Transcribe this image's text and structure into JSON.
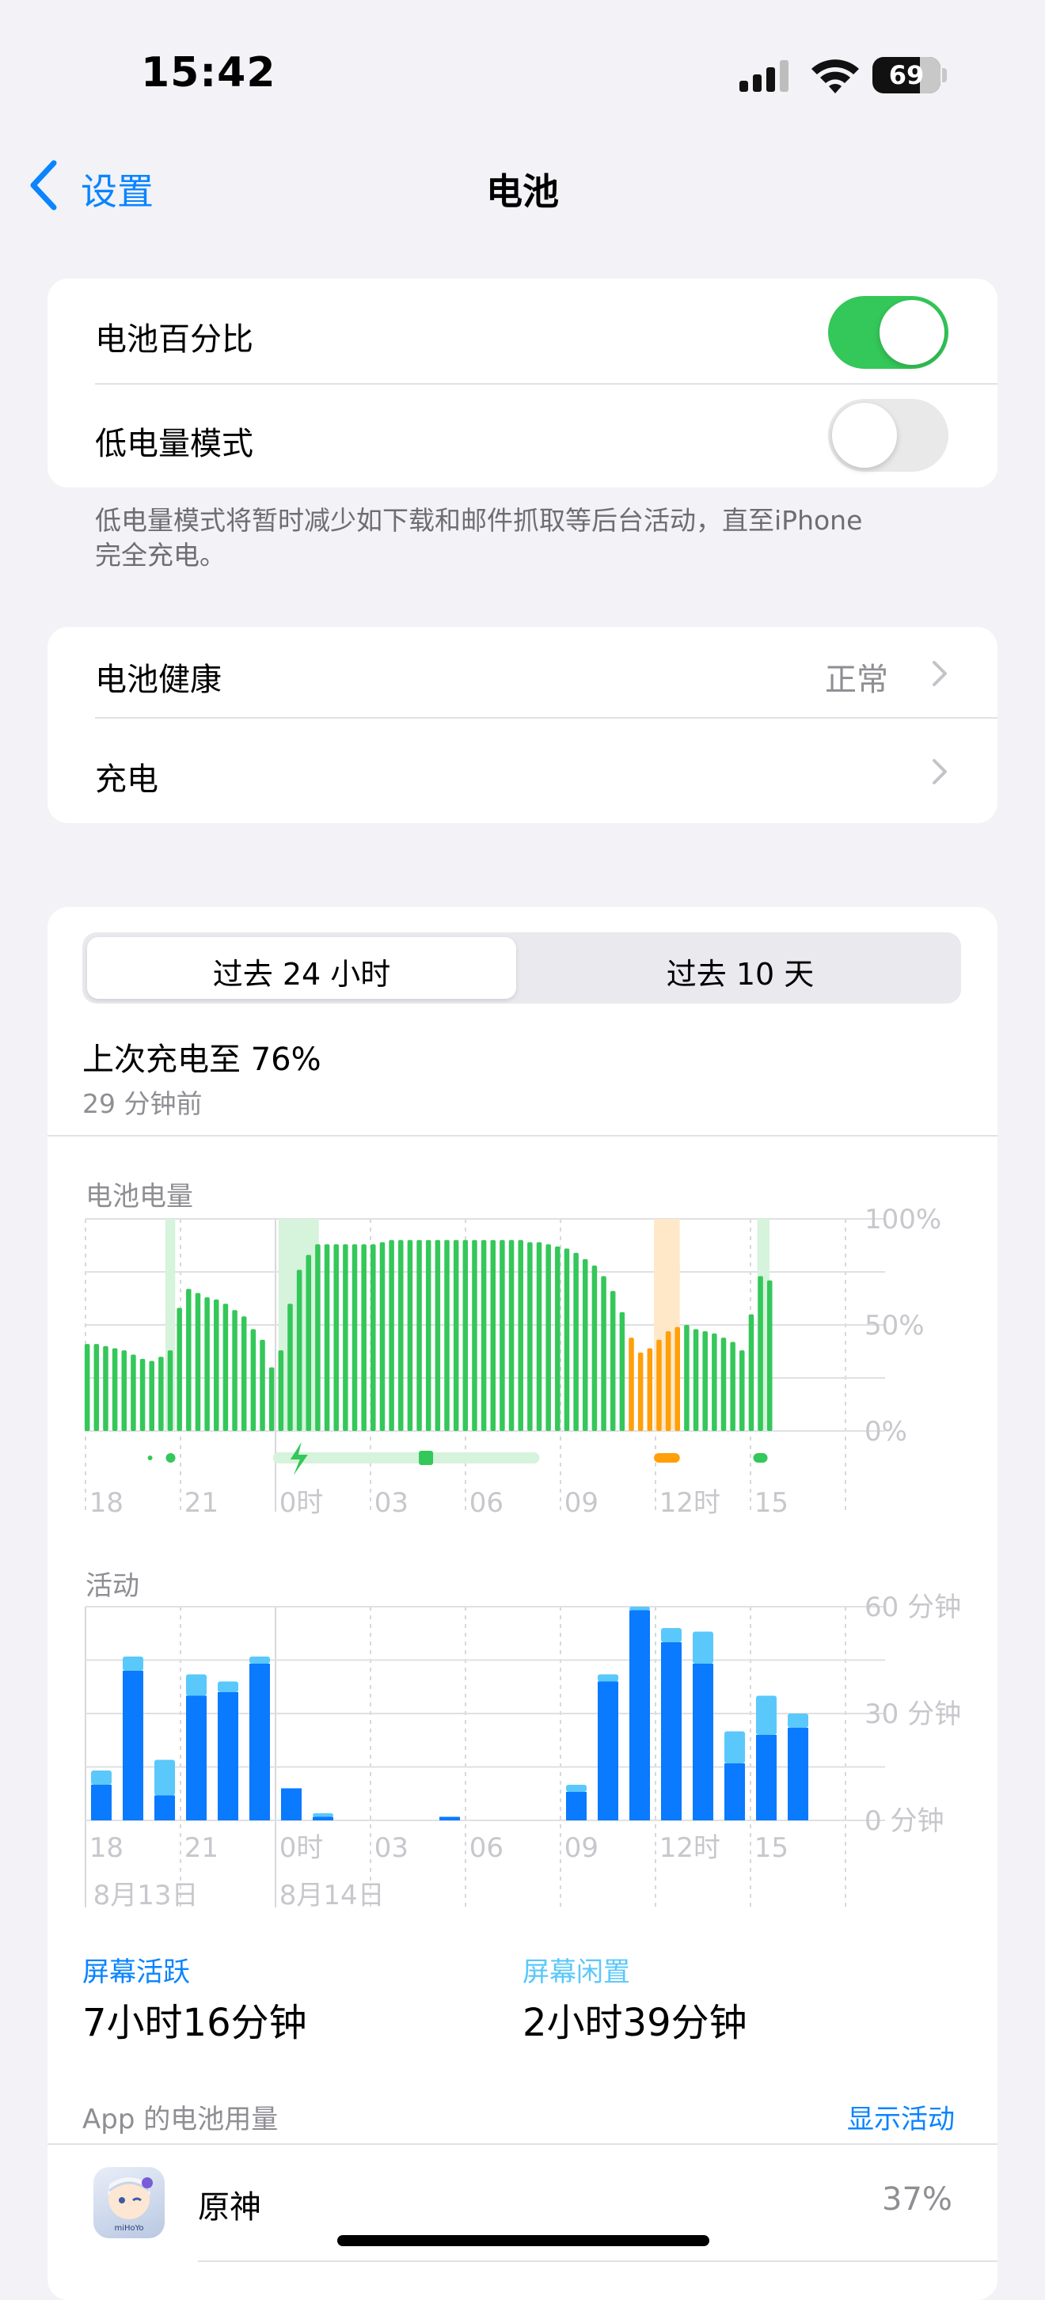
{
  "status_bar": {
    "time": "15:42",
    "battery_level": "69"
  },
  "nav": {
    "back_label": "设置",
    "title": "电池"
  },
  "toggles_section": {
    "battery_percentage_label": "电池百分比",
    "battery_percentage_on": true,
    "low_power_label": "低电量模式",
    "low_power_on": false,
    "footnote_line1": "低电量模式将暂时减少如下载和邮件抓取等后台活动，直至iPhone",
    "footnote_line2": "完全充电。"
  },
  "health_section": {
    "health_label": "电池健康",
    "health_value": "正常",
    "charging_label": "充电"
  },
  "usage": {
    "tabs": [
      "过去 24 小时",
      "过去 10 天"
    ],
    "selected_tab": 0,
    "last_charge_title": "上次充电至 76%",
    "last_charge_time": "29 分钟前"
  },
  "colors": {
    "green": "#34c759",
    "orange": "#ff9f0a",
    "blue": "#0a7aff",
    "cyan": "#5ac8fa",
    "accent": "#0a84ff"
  },
  "chart_data": [
    {
      "type": "bar",
      "title": "电池电量",
      "y_ticks": [
        "100%",
        "50%",
        "0%"
      ],
      "ylim": [
        0,
        100
      ],
      "x_ticks": [
        "18",
        "21",
        "0时",
        "03",
        "06",
        "09",
        "12时",
        "15"
      ],
      "values": [
        41,
        41,
        40,
        39,
        38,
        36,
        34,
        33,
        35,
        38,
        58,
        67,
        65,
        63,
        62,
        60,
        57,
        54,
        48,
        43,
        30,
        38,
        60,
        76,
        83,
        88,
        88,
        88,
        88,
        88,
        88,
        88,
        89,
        90,
        90,
        90,
        90,
        90,
        90,
        90,
        90,
        90,
        90,
        90,
        90,
        90,
        90,
        90,
        89,
        89,
        88,
        87,
        86,
        84,
        81,
        78,
        73,
        66,
        56,
        44,
        37,
        39,
        43,
        47,
        49,
        50,
        48,
        47,
        46,
        44,
        42,
        38,
        55,
        73,
        71
      ],
      "low_power_indices": [
        59,
        60,
        61,
        62,
        63,
        64
      ]
    },
    {
      "type": "bar",
      "title": "活动",
      "y_ticks": [
        "60 分钟",
        "30 分钟",
        "0 分钟"
      ],
      "ylim": [
        0,
        60
      ],
      "x_ticks": [
        "18",
        "21",
        "0时",
        "03",
        "06",
        "09",
        "12时",
        "15"
      ],
      "date_labels": [
        "8月13日",
        "8月14日"
      ],
      "categories": [
        "18",
        "19",
        "20",
        "21",
        "22",
        "23",
        "0时",
        "01",
        "02",
        "03",
        "04",
        "05",
        "06",
        "07",
        "08",
        "09",
        "10",
        "11",
        "12时",
        "13",
        "14",
        "15"
      ],
      "series": [
        {
          "name": "屏幕活跃",
          "values": [
            10,
            42,
            7,
            35,
            36,
            44,
            9,
            1,
            0,
            0,
            0,
            1,
            0,
            0,
            0,
            8,
            39,
            59,
            50,
            44,
            16,
            24,
            26
          ]
        },
        {
          "name": "屏幕闲置",
          "values": [
            4,
            4,
            10,
            6,
            3,
            2,
            0,
            1,
            0,
            0,
            0,
            0,
            0,
            0,
            0,
            2,
            2,
            1,
            4,
            9,
            9,
            11,
            4
          ]
        }
      ]
    }
  ],
  "screen_summary": {
    "active_label": "屏幕活跃",
    "active_value": "7小时16分钟",
    "idle_label": "屏幕闲置",
    "idle_value": "2小时39分钟"
  },
  "apps": {
    "header": "App 的电池用量",
    "show_activity": "显示活动",
    "items": [
      {
        "name": "原神",
        "percent": "37%",
        "icon_caption": "miHoYo"
      }
    ]
  }
}
